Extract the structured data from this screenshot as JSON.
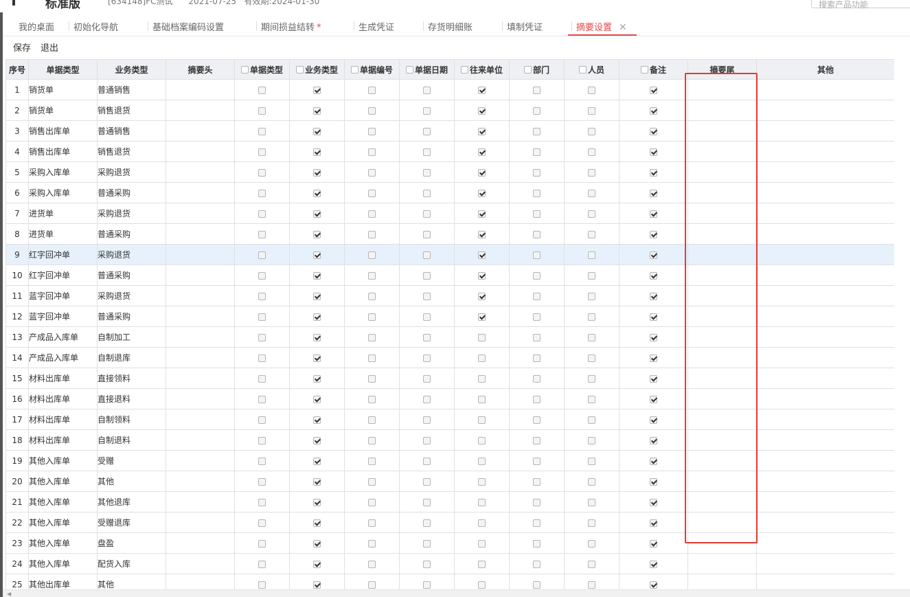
{
  "header": {
    "app_name": "标准版",
    "info": "[634148]FC测试      2021-07-25   有效期:2024-01-30",
    "search_placeholder": "搜索产品功能"
  },
  "tabs": [
    {
      "label": "我的桌面"
    },
    {
      "label": "初始化导航"
    },
    {
      "label": "基础档案编码设置"
    },
    {
      "label": "期间损益结转",
      "star": "*"
    },
    {
      "label": "生成凭证"
    },
    {
      "label": "存货明细账"
    },
    {
      "label": "填制凭证"
    },
    {
      "label": "摘要设置",
      "close": "✕"
    }
  ],
  "toolbar": {
    "save": "保存",
    "exit": "退出"
  },
  "grid": {
    "columns": [
      "序号",
      "单据类型",
      "业务类型",
      "摘要头",
      "单据类型",
      "业务类型",
      "单据编号",
      "单据日期",
      "往来单位",
      "部门",
      "人员",
      "备注",
      "摘要尾",
      "其他"
    ],
    "rows": [
      {
        "no": "1",
        "doc": "销货单",
        "biz": "普通销售",
        "flags": [
          0,
          1,
          0,
          0,
          1,
          0,
          0,
          1
        ]
      },
      {
        "no": "2",
        "doc": "销货单",
        "biz": "销售退货",
        "flags": [
          0,
          1,
          0,
          0,
          1,
          0,
          0,
          1
        ]
      },
      {
        "no": "3",
        "doc": "销售出库单",
        "biz": "普通销售",
        "flags": [
          0,
          1,
          0,
          0,
          1,
          0,
          0,
          1
        ]
      },
      {
        "no": "4",
        "doc": "销售出库单",
        "biz": "销售退货",
        "flags": [
          0,
          1,
          0,
          0,
          1,
          0,
          0,
          1
        ]
      },
      {
        "no": "5",
        "doc": "采购入库单",
        "biz": "采购退货",
        "flags": [
          0,
          1,
          0,
          0,
          1,
          0,
          0,
          1
        ]
      },
      {
        "no": "6",
        "doc": "采购入库单",
        "biz": "普通采购",
        "flags": [
          0,
          1,
          0,
          0,
          1,
          0,
          0,
          1
        ]
      },
      {
        "no": "7",
        "doc": "进货单",
        "biz": "采购退货",
        "flags": [
          0,
          1,
          0,
          0,
          1,
          0,
          0,
          1
        ]
      },
      {
        "no": "8",
        "doc": "进货单",
        "biz": "普通采购",
        "flags": [
          0,
          1,
          0,
          0,
          1,
          0,
          0,
          1
        ]
      },
      {
        "no": "9",
        "doc": "红字回冲单",
        "biz": "采购退货",
        "flags": [
          0,
          1,
          0,
          0,
          1,
          0,
          0,
          1
        ],
        "highlight": true
      },
      {
        "no": "10",
        "doc": "红字回冲单",
        "biz": "普通采购",
        "flags": [
          0,
          1,
          0,
          0,
          1,
          0,
          0,
          1
        ]
      },
      {
        "no": "11",
        "doc": "蓝字回冲单",
        "biz": "采购退货",
        "flags": [
          0,
          1,
          0,
          0,
          1,
          0,
          0,
          1
        ]
      },
      {
        "no": "12",
        "doc": "蓝字回冲单",
        "biz": "普通采购",
        "flags": [
          0,
          1,
          0,
          0,
          1,
          0,
          0,
          1
        ]
      },
      {
        "no": "13",
        "doc": "产成品入库单",
        "biz": "自制加工",
        "flags": [
          0,
          1,
          0,
          0,
          0,
          0,
          0,
          1
        ]
      },
      {
        "no": "14",
        "doc": "产成品入库单",
        "biz": "自制退库",
        "flags": [
          0,
          1,
          0,
          0,
          0,
          0,
          0,
          1
        ]
      },
      {
        "no": "15",
        "doc": "材料出库单",
        "biz": "直接领料",
        "flags": [
          0,
          1,
          0,
          0,
          0,
          0,
          0,
          1
        ]
      },
      {
        "no": "16",
        "doc": "材料出库单",
        "biz": "直接退料",
        "flags": [
          0,
          1,
          0,
          0,
          0,
          0,
          0,
          1
        ]
      },
      {
        "no": "17",
        "doc": "材料出库单",
        "biz": "自制领料",
        "flags": [
          0,
          1,
          0,
          0,
          0,
          0,
          0,
          1
        ]
      },
      {
        "no": "18",
        "doc": "材料出库单",
        "biz": "自制退料",
        "flags": [
          0,
          1,
          0,
          0,
          0,
          0,
          0,
          1
        ]
      },
      {
        "no": "19",
        "doc": "其他入库单",
        "biz": "受赠",
        "flags": [
          0,
          1,
          0,
          0,
          0,
          0,
          0,
          1
        ]
      },
      {
        "no": "20",
        "doc": "其他入库单",
        "biz": "其他",
        "flags": [
          0,
          1,
          0,
          0,
          0,
          0,
          0,
          1
        ]
      },
      {
        "no": "21",
        "doc": "其他入库单",
        "biz": "其他退库",
        "flags": [
          0,
          1,
          0,
          0,
          0,
          0,
          0,
          1
        ]
      },
      {
        "no": "22",
        "doc": "其他入库单",
        "biz": "受赠退库",
        "flags": [
          0,
          1,
          0,
          0,
          0,
          0,
          0,
          1
        ]
      },
      {
        "no": "23",
        "doc": "其他入库单",
        "biz": "盘盈",
        "flags": [
          0,
          1,
          0,
          0,
          0,
          0,
          0,
          1
        ]
      },
      {
        "no": "24",
        "doc": "其他入库单",
        "biz": "配货入库",
        "flags": [
          0,
          1,
          0,
          0,
          0,
          0,
          0,
          1
        ]
      },
      {
        "no": "25",
        "doc": "其他出库单",
        "biz": "其他",
        "flags": [
          0,
          1,
          0,
          0,
          0,
          0,
          0,
          1
        ]
      }
    ]
  },
  "colors": {
    "accent": "#e54b4b",
    "annotation": "#e53935",
    "row_highlight": "#e6f1fc",
    "header_bg": "#eef0f3"
  },
  "icons": {
    "tab_close": "close-icon",
    "checkbox": "checkbox-icon"
  }
}
